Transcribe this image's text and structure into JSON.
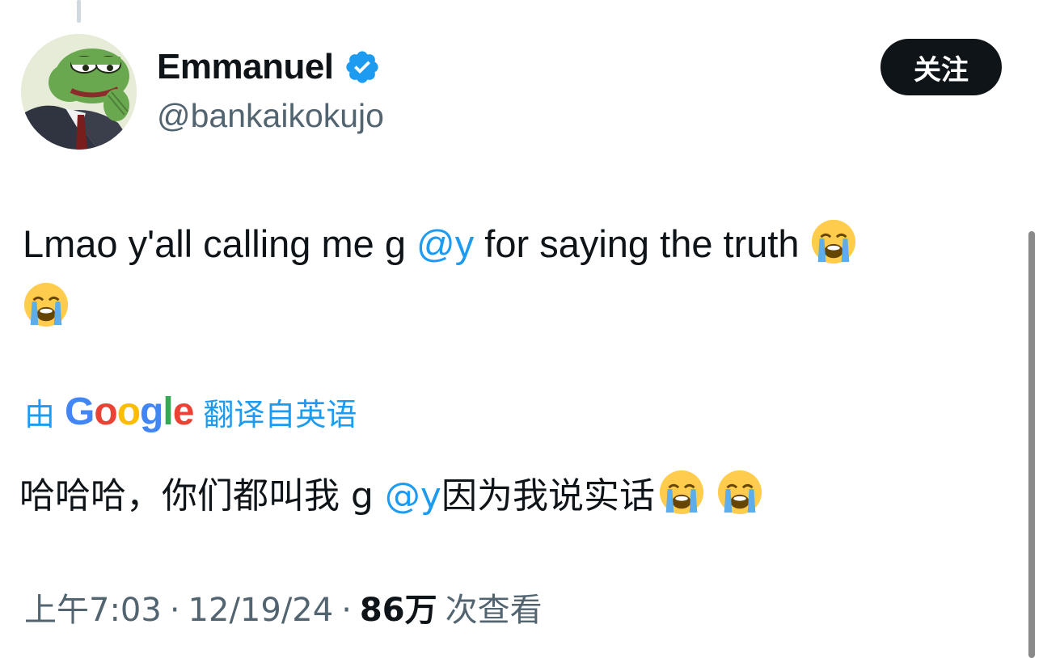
{
  "author": {
    "display_name": "Emmanuel",
    "handle": "@bankaikokujo",
    "avatar_icon": "pepe-frog-avatar",
    "verified_icon": "verified-badge-icon",
    "verified_color": "#1d9bf0"
  },
  "follow_button": {
    "label": "关注"
  },
  "tweet": {
    "text_before": "Lmao y'all calling me g ",
    "mention": "@y",
    "text_after": " for saying the truth ",
    "emoji_icon": "loudly-crying-face-emoji"
  },
  "translation": {
    "prefix": "由",
    "provider": "Google",
    "suffix": "翻译自英语",
    "text_before": "哈哈哈，你们都叫我 g ",
    "mention": "@y",
    "text_after": "因为我说实话"
  },
  "meta": {
    "time": "上午7:03",
    "separator": "·",
    "date": "12/19/24",
    "views_count": "86万",
    "views_label": "次查看"
  },
  "colors": {
    "accent": "#1d9bf0",
    "text": "#0f1419",
    "secondary": "#536471",
    "button_bg": "#0f1419"
  }
}
